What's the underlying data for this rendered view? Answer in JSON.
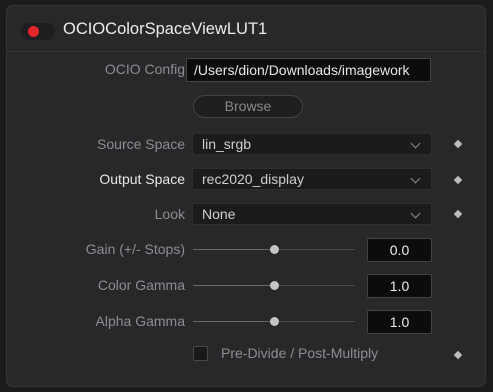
{
  "node": {
    "title": "OCIOColorSpaceViewLUT1",
    "enabled": true,
    "accent_color": "#e5262a"
  },
  "ocio_config": {
    "label": "OCIO Config",
    "value": "/Users/dion/Downloads/imagework",
    "browse_label": "Browse"
  },
  "source_space": {
    "label": "Source Space",
    "value": "lin_srgb"
  },
  "output_space": {
    "label": "Output Space",
    "value": "rec2020_display"
  },
  "look": {
    "label": "Look",
    "value": "None"
  },
  "gain": {
    "label": "Gain (+/- Stops)",
    "value": "0.0",
    "fraction": 0.5
  },
  "color_gamma": {
    "label": "Color Gamma",
    "value": "1.0",
    "fraction": 0.5
  },
  "alpha_gamma": {
    "label": "Alpha Gamma",
    "value": "1.0",
    "fraction": 0.5
  },
  "predivide": {
    "label": "Pre-Divide / Post-Multiply",
    "checked": false
  },
  "icons": {
    "chevron": "chevron-down-icon",
    "keyframe": "keyframe-diamond-icon"
  }
}
